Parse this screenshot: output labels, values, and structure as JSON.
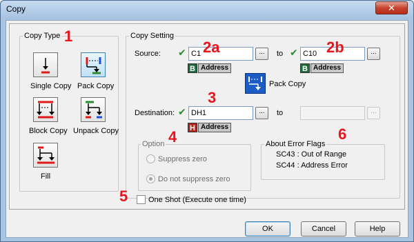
{
  "window": {
    "title": "Copy",
    "close_glyph": "✕"
  },
  "copy_type": {
    "label": "Copy Type",
    "buttons": [
      {
        "id": "single",
        "caption": "Single Copy",
        "icon": "single-copy-icon",
        "selected": false
      },
      {
        "id": "pack",
        "caption": "Pack Copy",
        "icon": "pack-copy-icon",
        "selected": true
      },
      {
        "id": "block",
        "caption": "Block Copy",
        "icon": "block-copy-icon",
        "selected": false
      },
      {
        "id": "unpack",
        "caption": "Unpack Copy",
        "icon": "unpack-copy-icon",
        "selected": false
      },
      {
        "id": "fill",
        "caption": "Fill",
        "icon": "fill-icon",
        "selected": false
      }
    ]
  },
  "copy_setting": {
    "label": "Copy Setting",
    "source_label": "Source:",
    "source_value": "C1",
    "to_label": "to",
    "source_to_value": "C10",
    "browse_label": "...",
    "source_tag": {
      "letter": "B",
      "text": "Address",
      "color": "#1f6b3e"
    },
    "source_to_tag": {
      "letter": "B",
      "text": "Address",
      "color": "#1f6b3e"
    },
    "pack_copy_label": "Pack Copy",
    "destination_label": "Destination:",
    "destination_value": "DH1",
    "destination_to_value": "",
    "destination_tag": {
      "letter": "H",
      "text": "Address",
      "color": "#b0251c"
    }
  },
  "option": {
    "label": "Option",
    "suppress_zero": "Suppress zero",
    "no_suppress_zero": "Do not suppress zero",
    "selected": "no_suppress_zero"
  },
  "error_flags": {
    "label": "About Error Flags",
    "lines": [
      "SC43 : Out of Range",
      "SC44 : Address Error"
    ]
  },
  "one_shot": {
    "label": "One Shot (Execute one time)",
    "checked": false
  },
  "buttons": {
    "ok": "OK",
    "cancel": "Cancel",
    "help": "Help"
  },
  "annotations": [
    "1",
    "2a",
    "2b",
    "3",
    "4",
    "5",
    "6"
  ],
  "colors": {
    "annotation": "#e8161c",
    "check": "#2e8b2e",
    "pack_icon": "#1c5cc6"
  }
}
